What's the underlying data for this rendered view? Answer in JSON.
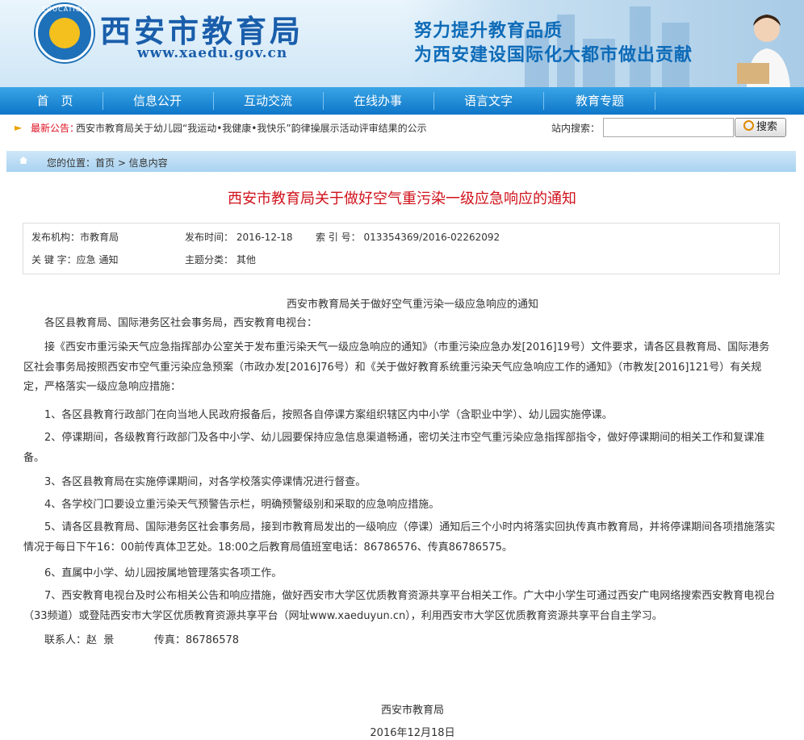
{
  "header": {
    "logo_text": "EDUCATION",
    "title": "西安市教育局",
    "url": "www.xaedu.gov.cn",
    "slogan_line1": "努力提升教育品质",
    "slogan_line2": "为西安建设国际化大都市做出贡献"
  },
  "nav": {
    "items": [
      "首　页",
      "信息公开",
      "互动交流",
      "在线办事",
      "语言文字",
      "教育专题"
    ]
  },
  "notice": {
    "label": "最新公告：",
    "text": "西安市教育局关于幼儿园“我运动•我健康•我快乐”韵律操展示活动评审结果的公示"
  },
  "search": {
    "label": "站内搜索：",
    "placeholder": "",
    "button": "搜索"
  },
  "breadcrumb": "您的位置：首页 > 信息内容",
  "article": {
    "title": "西安市教育局关于做好空气重污染一级应急响应的通知",
    "meta": {
      "publisher": "发布机构：市教育局",
      "publish_time": "发布时间：  2016-12-18",
      "index_no": "索 引 号：  013354369/2016-02262092",
      "keywords": "关 键 字：应急 通知",
      "category": "主题分类：  其他"
    },
    "doc_title": "西安市教育局关于做好空气重污染一级应急响应的通知",
    "paragraphs": [
      "各区县教育局、国际港务区社会事务局，西安教育电视台：",
      "接《西安市重污染天气应急指挥部办公室关于发布重污染天气一级应急响应的通知》（市重污染应急办发[2016]19号）文件要求，请各区县教育局、国际港务区社会事务局按照西安市空气重污染应急预案（市政办发[2016]76号）和《关于做好教育系统重污染天气应急响应工作的通知》（市教发[2016]121号）有关规定，严格落实一级应急响应措施：",
      "1、各区县教育行政部门在向当地人民政府报备后，按照各自停课方案组织辖区内中小学（含职业中学）、幼儿园实施停课。",
      "2、停课期间，各级教育行政部门及各中小学、幼儿园要保持应急信息渠道畅通，密切关注市空气重污染应急指挥部指令，做好停课期间的相关工作和复课准备。",
      "3、各区县教育局在实施停课期间，对各学校落实停课情况进行督查。",
      "4、各学校门口要设立重污染天气预警告示栏，明确预警级别和采取的应急响应措施。",
      "5、请各区县教育局、国际港务区社会事务局，接到市教育局发出的一级响应（停课）通知后三个小时内将落实回执传真市教育局，并将停课期间各项措施落实情况于每日下午16：00前传真体卫艺处。18:00之后教育局值班室电话：86786576、传真86786575。",
      "6、直属中小学、幼儿园按属地管理落实各项工作。",
      "7、西安教育电视台及时公布相关公告和响应措施，做好西安市大学区优质教育资源共享平台相关工作。广大中小学生可通过西安广电网络搜索西安教育电视台（33频道）或登陆西安市大学区优质教育资源共享平台（网址www.xaeduyun.cn），利用西安市大学区优质教育资源共享平台自主学习。",
      "联系人：赵  景            传真：86786578"
    ],
    "signature": "西安市教育局",
    "date": "2016年12月18日"
  }
}
